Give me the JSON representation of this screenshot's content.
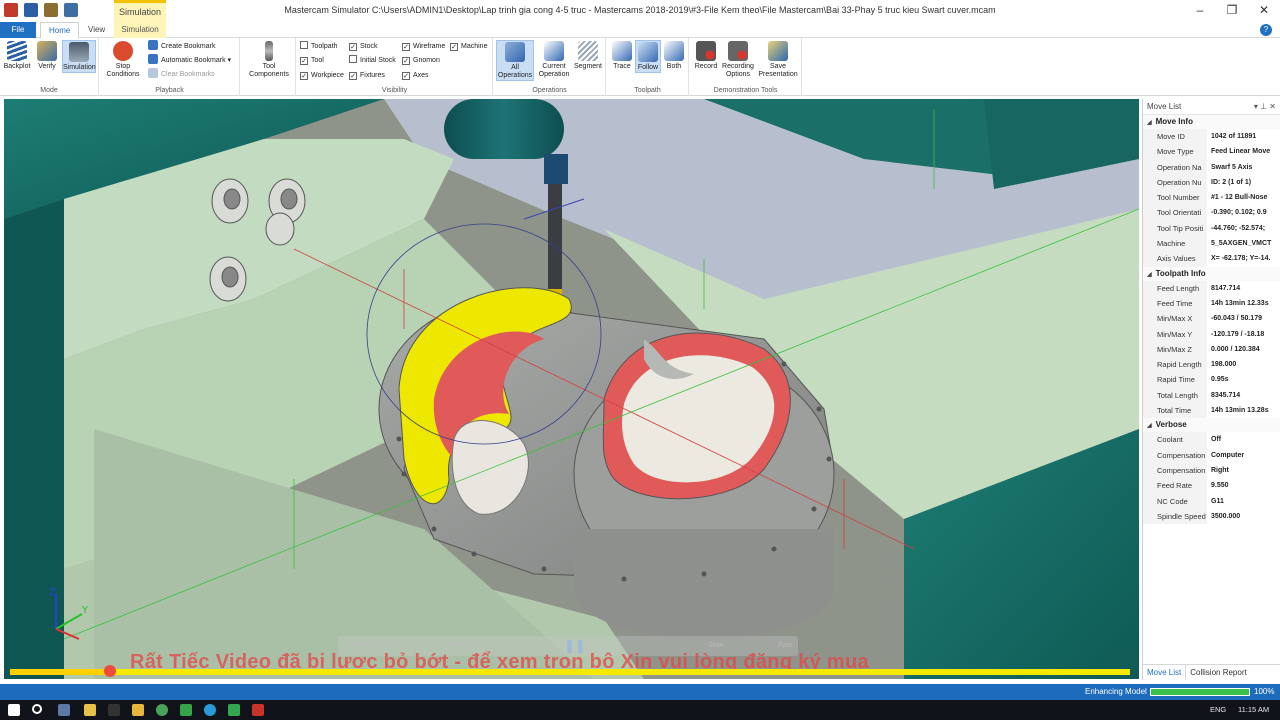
{
  "window": {
    "title": "Mastercam Simulator  C:\\Users\\ADMIN1\\Desktop\\Lap trinh gia cong 4-5 truc - Mastercams 2018-2019\\#3-File Kem theo\\File Mastercam\\Bai 33-Phay 5 truc kieu Swart cuver.mcam",
    "context_tab": "Simulation",
    "controls": [
      "–",
      "❐",
      "✕"
    ]
  },
  "tabs": {
    "file": "File",
    "home": "Home",
    "view": "View",
    "simulation": "Simulation"
  },
  "ribbon": {
    "mode": {
      "label": "Mode",
      "buttons": [
        "Backplot",
        "Verify",
        "Simulation"
      ]
    },
    "playback": {
      "label": "Playback",
      "stop": "Stop\nConditions",
      "items": [
        "Create Bookmark",
        "Automatic Bookmark",
        "Clear Bookmarks"
      ]
    },
    "tool_components": "Tool\nComponents",
    "visibility": {
      "label": "Visibility",
      "col1": [
        {
          "text": "Toolpath",
          "checked": false
        },
        {
          "text": "Tool",
          "checked": true
        },
        {
          "text": "Workpiece",
          "checked": true
        }
      ],
      "col2": [
        {
          "text": "Stock",
          "checked": true
        },
        {
          "text": "Initial Stock",
          "checked": false
        },
        {
          "text": "Fixtures",
          "checked": true
        }
      ],
      "col3": [
        {
          "text": "Wireframe",
          "checked": true
        },
        {
          "text": "Gnomon",
          "checked": true
        },
        {
          "text": "Axes",
          "checked": true
        }
      ],
      "col4": [
        {
          "text": "Machine",
          "checked": true
        }
      ]
    },
    "operations": {
      "label": "Operations",
      "buttons": [
        "All\nOperations",
        "Current\nOperation",
        "Segment"
      ]
    },
    "toolpath": {
      "label": "Toolpath",
      "buttons": [
        "Trace",
        "Follow",
        "Both"
      ]
    },
    "demo": {
      "label": "Demonstration Tools",
      "buttons": [
        "Record",
        "Recording\nOptions",
        "Save\nPresentation"
      ]
    }
  },
  "playback_bar": {
    "performance": "Performance",
    "precision": "Precision",
    "slow": "Slow",
    "fast": "Fast",
    "watermark": "Rất Tiếc Video đã bị lược bỏ bớt - để xem trọn bộ Xin vui lòng đăng ký mua",
    "progress": 0.087
  },
  "move_list": {
    "title": "Move List",
    "sections": [
      {
        "name": "Move Info",
        "rows": [
          [
            "Move ID",
            "1042 of 11891"
          ],
          [
            "Move Type",
            "Feed Linear Move"
          ],
          [
            "Operation Na",
            "Swarf 5 Axis"
          ],
          [
            "Operation Nu",
            "ID: 2 (1 of 1)"
          ],
          [
            "Tool Number",
            "#1 - 12 Bull-Nose"
          ],
          [
            "Tool Orientati",
            "-0.390; 0.102; 0.9"
          ],
          [
            "Tool Tip Positi",
            "-44.760; -52.574;"
          ],
          [
            "Machine",
            "5_5AXGEN_VMCT"
          ],
          [
            "Axis Values",
            "X= -62.178; Y=-14."
          ]
        ]
      },
      {
        "name": "Toolpath Info",
        "rows": [
          [
            "Feed Length",
            "8147.714"
          ],
          [
            "Feed Time",
            "14h 13min 12.33s"
          ],
          [
            "Min/Max X",
            "-60.043 / 50.179"
          ],
          [
            "Min/Max Y",
            "-120.179 / -18.18"
          ],
          [
            "Min/Max Z",
            "0.000 / 120.384"
          ],
          [
            "Rapid Length",
            "198.000"
          ],
          [
            "Rapid Time",
            "0.95s"
          ],
          [
            "Total Length",
            "8345.714"
          ],
          [
            "Total Time",
            "14h 13min 13.28s"
          ]
        ]
      },
      {
        "name": "Verbose",
        "rows": [
          [
            "Coolant",
            "Off"
          ],
          [
            "Compensation",
            "Computer"
          ],
          [
            "Compensation",
            "Right"
          ],
          [
            "Feed Rate",
            "9.550"
          ],
          [
            "NC Code",
            "G11"
          ],
          [
            "Spindle Speed",
            "3500.000"
          ]
        ]
      }
    ],
    "tabs": [
      "Move List",
      "Collision Report"
    ]
  },
  "status": {
    "label": "Enhancing Model",
    "percent": "100%",
    "fill": 1.0
  },
  "taskbar": {
    "lang": "ENG",
    "time": "11:15 AM"
  },
  "colors": {
    "accent": "#1f6fc2",
    "fixture": "#c4dcc0",
    "teal": "#1a6f68",
    "cut": "#e05a5a",
    "tool_edge": "#f0e000"
  }
}
